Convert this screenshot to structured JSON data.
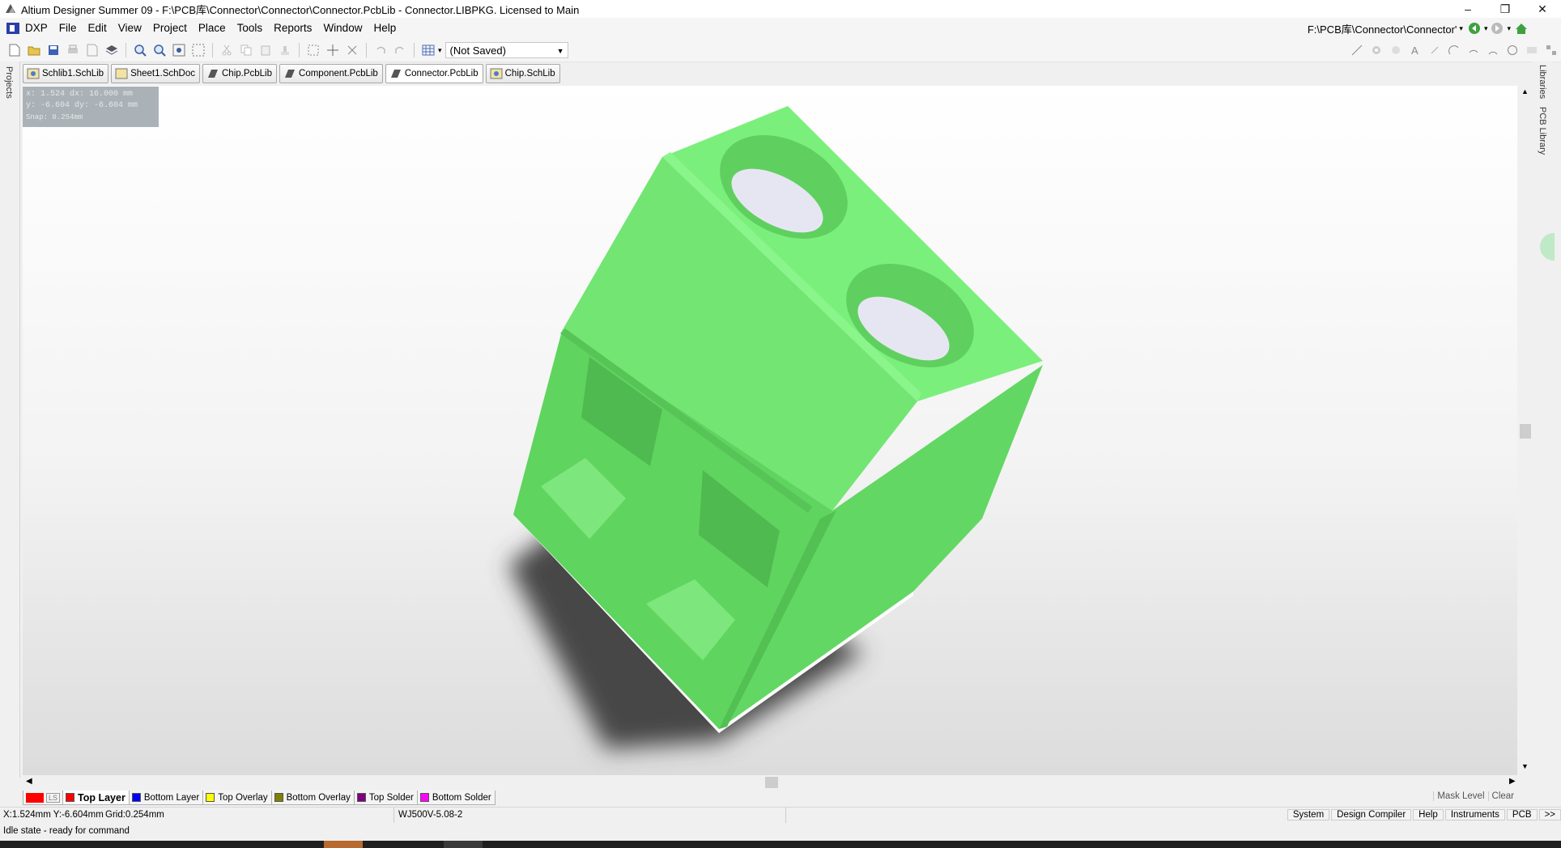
{
  "window": {
    "title": "Altium Designer Summer 09 - F:\\PCB库\\Connector\\Connector\\Connector.PcbLib - Connector.LIBPKG. Licensed to Main",
    "minimize": "–",
    "restore": "❐",
    "close": "✕"
  },
  "menu": {
    "dxp": "DXP",
    "file": "File",
    "edit": "Edit",
    "view": "View",
    "project": "Project",
    "place": "Place",
    "tools": "Tools",
    "reports": "Reports",
    "window": "Window",
    "help": "Help",
    "path": "F:\\PCB库\\Connector\\Connector'"
  },
  "toolbar": {
    "config_value": "(Not Saved)"
  },
  "doc_tabs": [
    "Schlib1.SchLib",
    "Sheet1.SchDoc",
    "Chip.PcbLib",
    "Component.PcbLib",
    "Connector.PcbLib",
    "Chip.SchLib"
  ],
  "side_panels": {
    "left": "Projects",
    "right_1": "Libraries",
    "right_2": "PCB Library"
  },
  "readout": {
    "line1": "x: 1.524   dx: 16.000 mm",
    "line2": "y: -6.604   dy: -6.604 mm",
    "line3": "Snap: 0.254mm"
  },
  "layers": {
    "current_label": "LS",
    "items": [
      {
        "name": "Top Layer",
        "color": "#ff0000"
      },
      {
        "name": "Bottom Layer",
        "color": "#0000ff"
      },
      {
        "name": "Top Overlay",
        "color": "#ffff00"
      },
      {
        "name": "Bottom Overlay",
        "color": "#808000"
      },
      {
        "name": "Top Solder",
        "color": "#800080"
      },
      {
        "name": "Bottom Solder",
        "color": "#ff00ff"
      }
    ],
    "mask_level": "Mask Level",
    "clear": "Clear"
  },
  "status": {
    "coords": "X:1.524mm Y:-6.604mm",
    "grid": "Grid:0.254mm",
    "component": "WJ500V-5.08-2",
    "idle": "Idle state - ready for command",
    "panels": [
      "System",
      "Design Compiler",
      "Help",
      "Instruments",
      "PCB"
    ],
    "more": ">>"
  },
  "model": {
    "body_color": "#6fe06f",
    "top_color": "#7bef7b",
    "shadow_color": "#474747"
  }
}
